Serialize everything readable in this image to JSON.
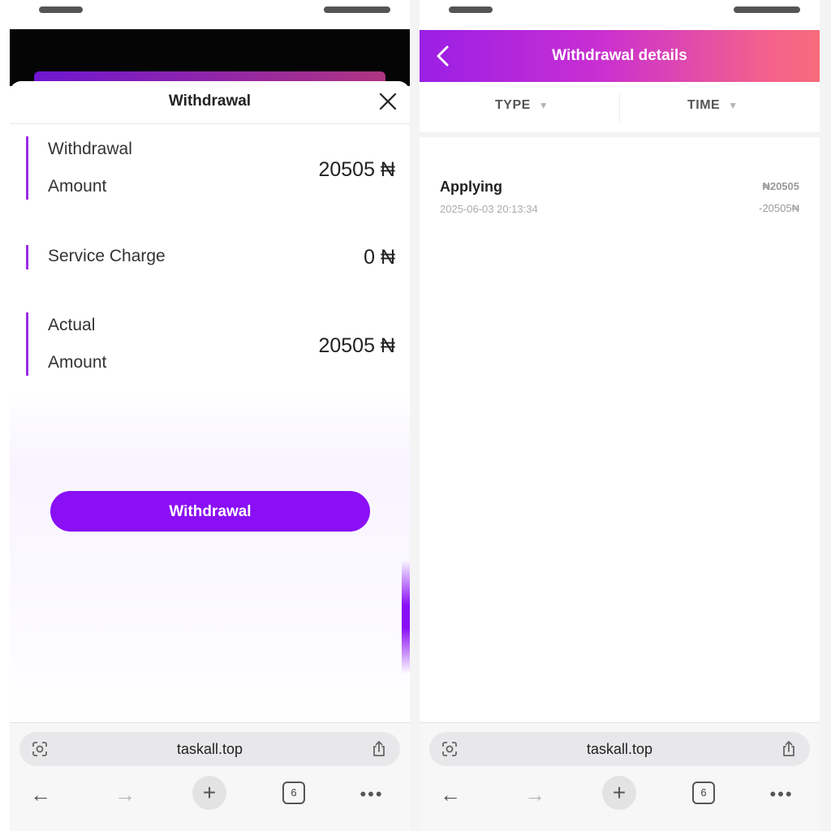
{
  "left": {
    "sheet_title": "Withdrawal",
    "rows": [
      {
        "label_line1": "Withdrawal",
        "label_line2": "Amount",
        "value": "20505 ₦"
      },
      {
        "label_line1": "Service Charge",
        "value": "0 ₦"
      },
      {
        "label_line1": "Actual",
        "label_line2": "Amount",
        "value": "20505 ₦"
      }
    ],
    "cta_label": "Withdrawal"
  },
  "right": {
    "title": "Withdrawal details",
    "filters": {
      "type_label": "TYPE",
      "time_label": "TIME"
    },
    "records": [
      {
        "status": "Applying",
        "datetime": "2025-06-03 20:13:34",
        "amount": "₦20505",
        "delta": "-20505₦"
      }
    ]
  },
  "browser": {
    "url": "taskall.top",
    "tab_count": "6",
    "icons": [
      "page-scan-icon",
      "share-icon",
      "back-arrow-icon",
      "forward-arrow-icon",
      "new-tab-plus-icon",
      "tabs-icon",
      "more-icon"
    ]
  },
  "colors": {
    "accent": "#8a0ff5",
    "header_gradient_start": "#9b1fe6",
    "header_gradient_end": "#f86b7a"
  }
}
